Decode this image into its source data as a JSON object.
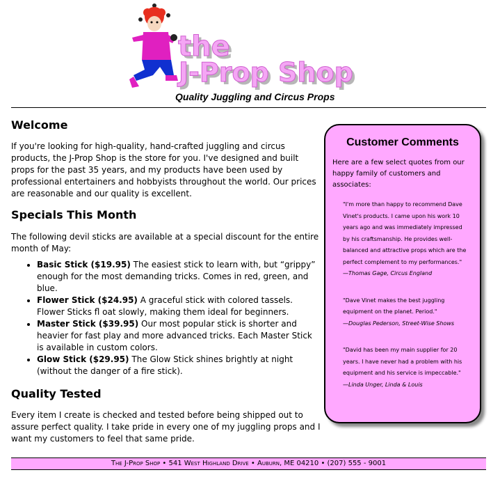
{
  "header": {
    "logo_line1": "the",
    "logo_line2": "J-Prop Shop",
    "tagline": "Quality Juggling and Circus Props"
  },
  "welcome": {
    "heading": "Welcome",
    "text": "If you're looking for high-quality, hand-crafted juggling and circus products, the J-Prop Shop is the store for you. I've designed and built props for the past 35 years, and my products have been used by professional entertainers and hobbyists throughout the world. Our prices are reasonable and our quality is excellent."
  },
  "specials": {
    "heading": "Specials This Month",
    "intro": "The following devil sticks are available at a special discount for the entire month of May:",
    "items": [
      {
        "name": "Basic Stick ($19.95)",
        "desc": " The easiest stick to learn with, but “grippy” enough for the most demanding tricks. Comes in red, green, and blue."
      },
      {
        "name": "Flower Stick ($24.95)",
        "desc": " A graceful stick with colored tassels. Flower Sticks fl oat slowly, making them ideal for beginners."
      },
      {
        "name": "Master Stick ($39.95)",
        "desc": " Our most popular stick is shorter and heavier for fast play and more advanced tricks. Each Master Stick is available in custom colors."
      },
      {
        "name": "Glow Stick ($29.95)",
        "desc": " The Glow Stick shines brightly at night (without the danger of a fire stick)."
      }
    ]
  },
  "quality": {
    "heading": "Quality Tested",
    "text": "Every item I create is checked and tested before being shipped out to assure perfect quality. I take pride in every one of my juggling props and I want my customers to feel that same pride."
  },
  "sidebar": {
    "heading": "Customer Comments",
    "intro": "Here are a few select quotes from our happy family of customers and associates:",
    "quotes": [
      {
        "text": "\"I'm more than happy to recommend Dave Vinet's products. I came upon his work 10 years ago and was immediately impressed by his craftsmanship. He provides well-balanced and attractive props which are the perfect complement to my performances.\"",
        "attribution": "—Thomas Gage, Circus England"
      },
      {
        "text": "\"Dave Vinet makes the best juggling equipment on the planet. Period.\"",
        "attribution": "—Douglas Pederson, Street-Wise Shows"
      },
      {
        "text": "\"David has been my main supplier for 20 years. I have never had a problem with his equipment and his service is impeccable.\"",
        "attribution": "—Linda Unger, Linda & Louis"
      }
    ]
  },
  "footer": {
    "text": "The J-Prop Shop • 541 West Highland Drive • Auburn, ME 04210 • (207) 555 - 9001"
  },
  "colors": {
    "accent_pink": "#ffa8ff",
    "logo_text": "#f0a0f0"
  }
}
